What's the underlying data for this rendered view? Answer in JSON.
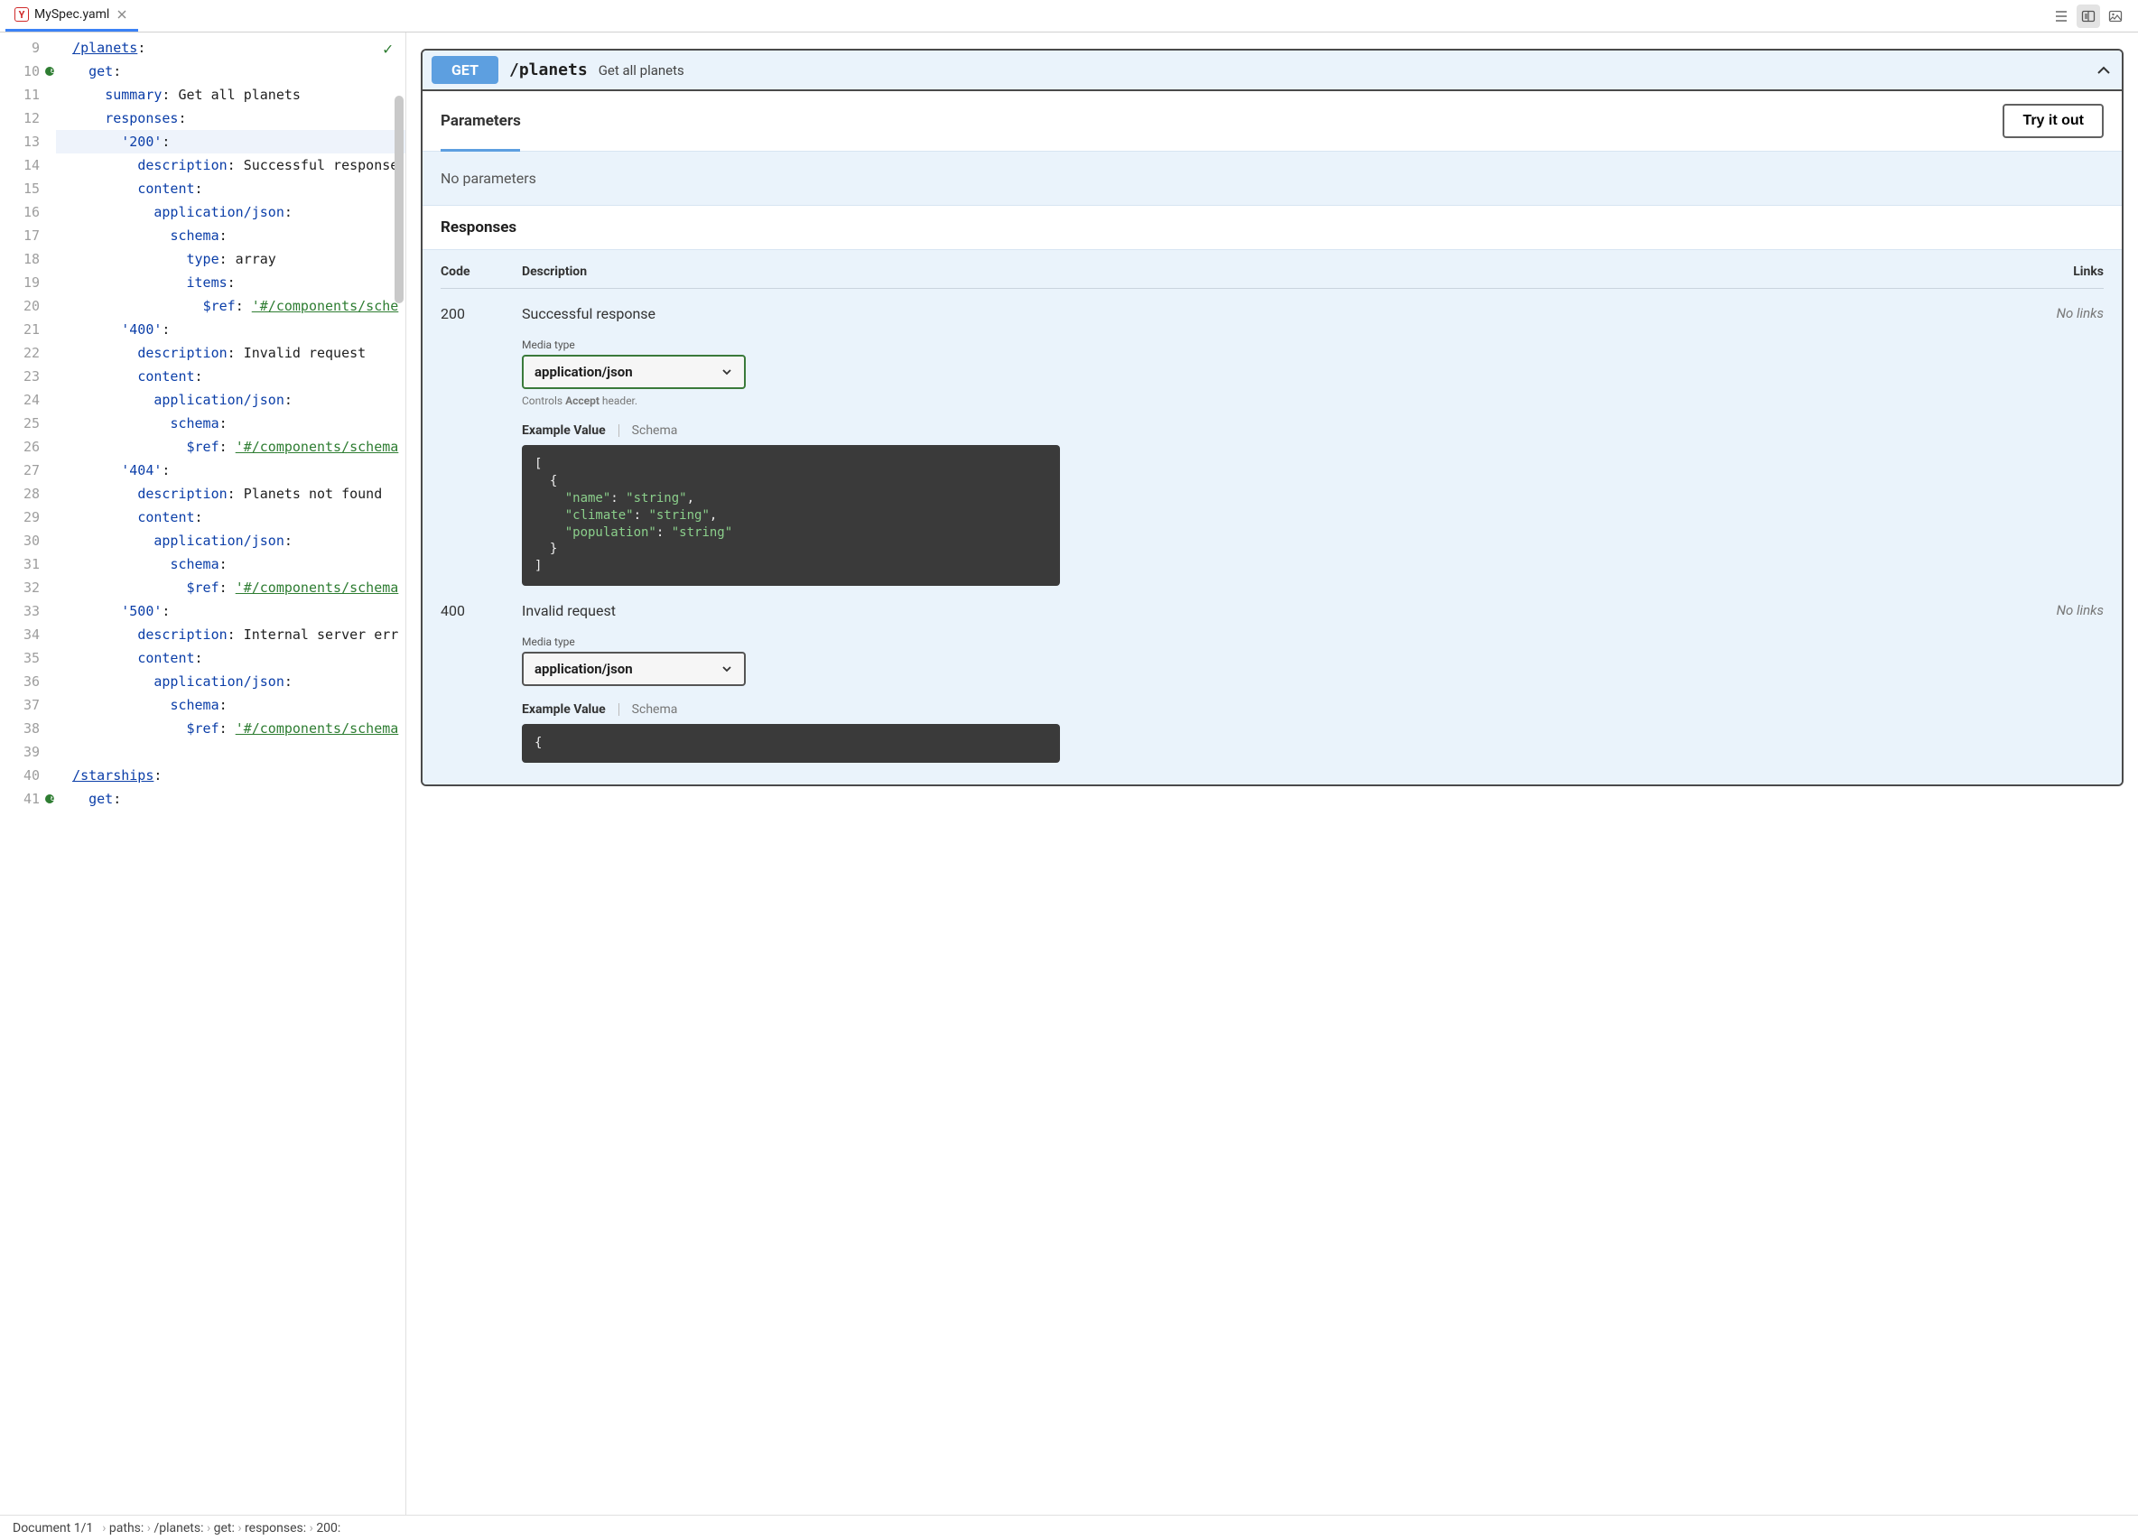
{
  "tab": {
    "filename": "MySpec.yaml"
  },
  "editor": {
    "check_ok": true,
    "lines": [
      {
        "n": 9,
        "hl": false,
        "mark": false,
        "indent": 2,
        "tokens": [
          [
            "key-link",
            "/planets"
          ],
          [
            "str",
            ":"
          ]
        ]
      },
      {
        "n": 10,
        "hl": false,
        "mark": true,
        "indent": 4,
        "tokens": [
          [
            "key",
            "get"
          ],
          [
            "str",
            ":"
          ]
        ]
      },
      {
        "n": 11,
        "hl": false,
        "mark": false,
        "indent": 6,
        "tokens": [
          [
            "key",
            "summary"
          ],
          [
            "str",
            ": Get all planets"
          ]
        ]
      },
      {
        "n": 12,
        "hl": false,
        "mark": false,
        "indent": 6,
        "tokens": [
          [
            "key",
            "responses"
          ],
          [
            "str",
            ":"
          ]
        ]
      },
      {
        "n": 13,
        "hl": true,
        "mark": false,
        "indent": 8,
        "tokens": [
          [
            "key",
            "'200'"
          ],
          [
            "str",
            ":"
          ]
        ]
      },
      {
        "n": 14,
        "hl": false,
        "mark": false,
        "indent": 10,
        "tokens": [
          [
            "key",
            "description"
          ],
          [
            "str",
            ": Successful response"
          ]
        ]
      },
      {
        "n": 15,
        "hl": false,
        "mark": false,
        "indent": 10,
        "tokens": [
          [
            "key",
            "content"
          ],
          [
            "str",
            ":"
          ]
        ]
      },
      {
        "n": 16,
        "hl": false,
        "mark": false,
        "indent": 12,
        "tokens": [
          [
            "key",
            "application/json"
          ],
          [
            "str",
            ":"
          ]
        ]
      },
      {
        "n": 17,
        "hl": false,
        "mark": false,
        "indent": 14,
        "tokens": [
          [
            "key",
            "schema"
          ],
          [
            "str",
            ":"
          ]
        ]
      },
      {
        "n": 18,
        "hl": false,
        "mark": false,
        "indent": 16,
        "tokens": [
          [
            "key",
            "type"
          ],
          [
            "str",
            ": array"
          ]
        ]
      },
      {
        "n": 19,
        "hl": false,
        "mark": false,
        "indent": 16,
        "tokens": [
          [
            "key",
            "items"
          ],
          [
            "str",
            ":"
          ]
        ]
      },
      {
        "n": 20,
        "hl": false,
        "mark": false,
        "indent": 18,
        "tokens": [
          [
            "key",
            "$ref"
          ],
          [
            "str",
            ": "
          ],
          [
            "ref",
            "'#/components/sche"
          ]
        ]
      },
      {
        "n": 21,
        "hl": false,
        "mark": false,
        "indent": 8,
        "tokens": [
          [
            "key",
            "'400'"
          ],
          [
            "str",
            ":"
          ]
        ]
      },
      {
        "n": 22,
        "hl": false,
        "mark": false,
        "indent": 10,
        "tokens": [
          [
            "key",
            "description"
          ],
          [
            "str",
            ": Invalid request"
          ]
        ]
      },
      {
        "n": 23,
        "hl": false,
        "mark": false,
        "indent": 10,
        "tokens": [
          [
            "key",
            "content"
          ],
          [
            "str",
            ":"
          ]
        ]
      },
      {
        "n": 24,
        "hl": false,
        "mark": false,
        "indent": 12,
        "tokens": [
          [
            "key",
            "application/json"
          ],
          [
            "str",
            ":"
          ]
        ]
      },
      {
        "n": 25,
        "hl": false,
        "mark": false,
        "indent": 14,
        "tokens": [
          [
            "key",
            "schema"
          ],
          [
            "str",
            ":"
          ]
        ]
      },
      {
        "n": 26,
        "hl": false,
        "mark": false,
        "indent": 16,
        "tokens": [
          [
            "key",
            "$ref"
          ],
          [
            "str",
            ": "
          ],
          [
            "ref",
            "'#/components/schema"
          ]
        ]
      },
      {
        "n": 27,
        "hl": false,
        "mark": false,
        "indent": 8,
        "tokens": [
          [
            "key",
            "'404'"
          ],
          [
            "str",
            ":"
          ]
        ]
      },
      {
        "n": 28,
        "hl": false,
        "mark": false,
        "indent": 10,
        "tokens": [
          [
            "key",
            "description"
          ],
          [
            "str",
            ": Planets not found"
          ]
        ]
      },
      {
        "n": 29,
        "hl": false,
        "mark": false,
        "indent": 10,
        "tokens": [
          [
            "key",
            "content"
          ],
          [
            "str",
            ":"
          ]
        ]
      },
      {
        "n": 30,
        "hl": false,
        "mark": false,
        "indent": 12,
        "tokens": [
          [
            "key",
            "application/json"
          ],
          [
            "str",
            ":"
          ]
        ]
      },
      {
        "n": 31,
        "hl": false,
        "mark": false,
        "indent": 14,
        "tokens": [
          [
            "key",
            "schema"
          ],
          [
            "str",
            ":"
          ]
        ]
      },
      {
        "n": 32,
        "hl": false,
        "mark": false,
        "indent": 16,
        "tokens": [
          [
            "key",
            "$ref"
          ],
          [
            "str",
            ": "
          ],
          [
            "ref",
            "'#/components/schema"
          ]
        ]
      },
      {
        "n": 33,
        "hl": false,
        "mark": false,
        "indent": 8,
        "tokens": [
          [
            "key",
            "'500'"
          ],
          [
            "str",
            ":"
          ]
        ]
      },
      {
        "n": 34,
        "hl": false,
        "mark": false,
        "indent": 10,
        "tokens": [
          [
            "key",
            "description"
          ],
          [
            "str",
            ": Internal server err"
          ]
        ]
      },
      {
        "n": 35,
        "hl": false,
        "mark": false,
        "indent": 10,
        "tokens": [
          [
            "key",
            "content"
          ],
          [
            "str",
            ":"
          ]
        ]
      },
      {
        "n": 36,
        "hl": false,
        "mark": false,
        "indent": 12,
        "tokens": [
          [
            "key",
            "application/json"
          ],
          [
            "str",
            ":"
          ]
        ]
      },
      {
        "n": 37,
        "hl": false,
        "mark": false,
        "indent": 14,
        "tokens": [
          [
            "key",
            "schema"
          ],
          [
            "str",
            ":"
          ]
        ]
      },
      {
        "n": 38,
        "hl": false,
        "mark": false,
        "indent": 16,
        "tokens": [
          [
            "key",
            "$ref"
          ],
          [
            "str",
            ": "
          ],
          [
            "ref",
            "'#/components/schema"
          ]
        ]
      },
      {
        "n": 39,
        "hl": false,
        "mark": false,
        "indent": 0,
        "tokens": []
      },
      {
        "n": 40,
        "hl": false,
        "mark": false,
        "indent": 2,
        "tokens": [
          [
            "key-link",
            "/starships"
          ],
          [
            "str",
            ":"
          ]
        ]
      },
      {
        "n": 41,
        "hl": false,
        "mark": true,
        "indent": 4,
        "tokens": [
          [
            "key",
            "get"
          ],
          [
            "str",
            ":"
          ]
        ]
      }
    ]
  },
  "preview": {
    "method": "GET",
    "path": "/planets",
    "summary": "Get all planets",
    "parameters_title": "Parameters",
    "try_label": "Try it out",
    "no_params": "No parameters",
    "responses_title": "Responses",
    "columns": {
      "code": "Code",
      "desc": "Description",
      "links": "Links"
    },
    "media_label": "Media type",
    "media_hint_prefix": "Controls ",
    "media_hint_bold": "Accept",
    "media_hint_suffix": " header.",
    "example_label": "Example Value",
    "schema_label": "Schema",
    "responses": [
      {
        "code": "200",
        "description": "Successful response",
        "links": "No links",
        "media_type": "application/json",
        "green_border": true,
        "show_hint": true,
        "example_lines": [
          [
            [
              "k",
              "["
            ]
          ],
          [
            [
              "k",
              "  {"
            ]
          ],
          [
            [
              "k",
              "    "
            ],
            [
              "s",
              "\"name\""
            ],
            [
              "k",
              ": "
            ],
            [
              "s",
              "\"string\""
            ],
            [
              "k",
              ","
            ]
          ],
          [
            [
              "k",
              "    "
            ],
            [
              "s",
              "\"climate\""
            ],
            [
              "k",
              ": "
            ],
            [
              "s",
              "\"string\""
            ],
            [
              "k",
              ","
            ]
          ],
          [
            [
              "k",
              "    "
            ],
            [
              "s",
              "\"population\""
            ],
            [
              "k",
              ": "
            ],
            [
              "s",
              "\"string\""
            ]
          ],
          [
            [
              "k",
              "  }"
            ]
          ],
          [
            [
              "k",
              "]"
            ]
          ]
        ]
      },
      {
        "code": "400",
        "description": "Invalid request",
        "links": "No links",
        "media_type": "application/json",
        "green_border": false,
        "show_hint": false,
        "example_lines": [
          [
            [
              "k",
              "{"
            ]
          ]
        ]
      }
    ]
  },
  "status": {
    "doc": "Document 1/1",
    "crumbs": [
      "paths:",
      "/planets:",
      "get:",
      "responses:",
      "200:"
    ]
  }
}
